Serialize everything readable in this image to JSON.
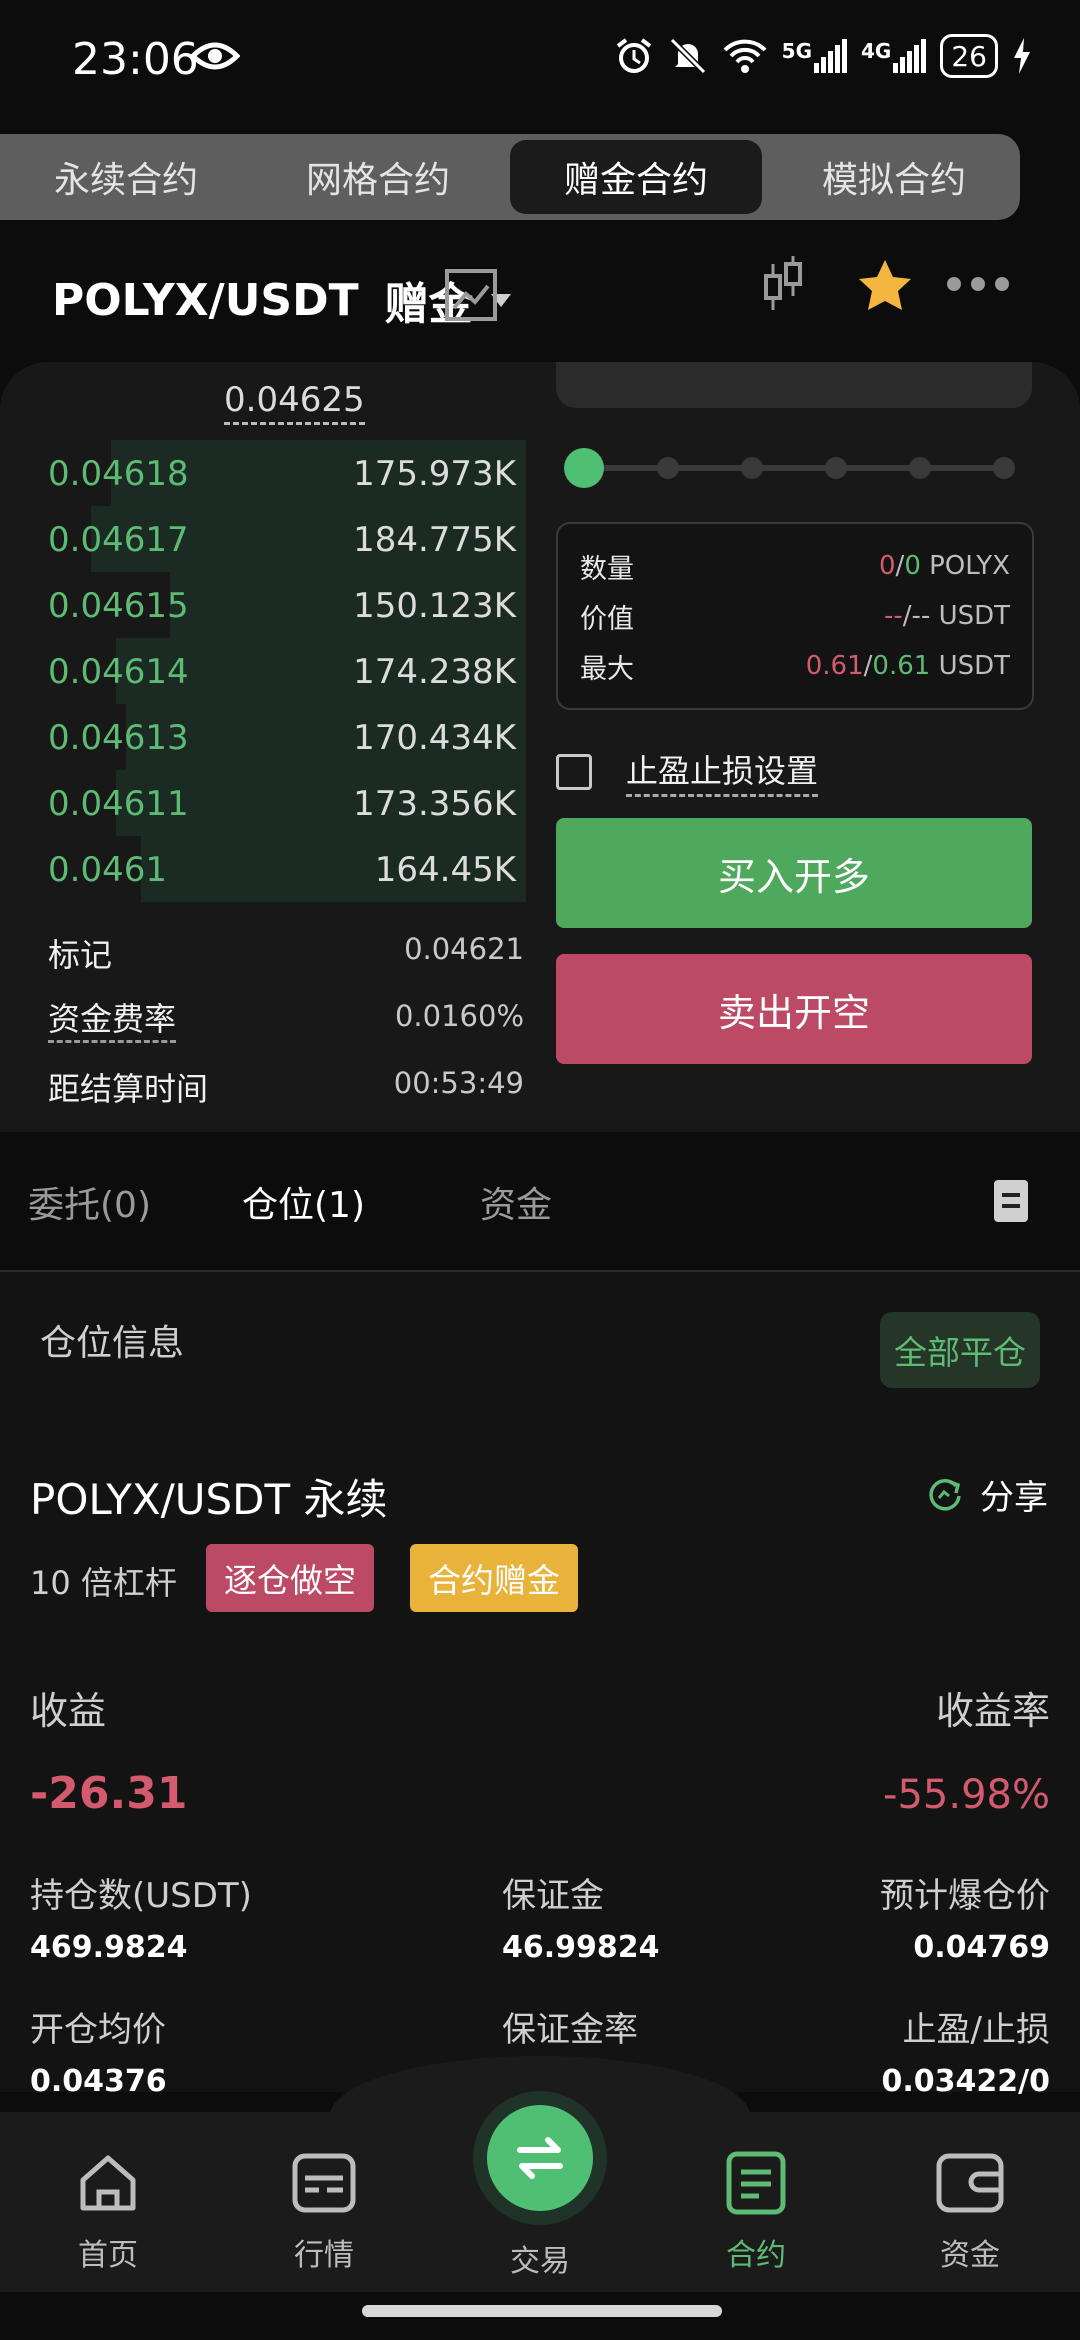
{
  "status_bar": {
    "time": "23:06",
    "net1": "5G",
    "net2": "4G",
    "battery": "26"
  },
  "mode_tabs": [
    {
      "label": "永续合约",
      "active": false
    },
    {
      "label": "网格合约",
      "active": false
    },
    {
      "label": "赠金合约",
      "active": true
    },
    {
      "label": "模拟合约",
      "active": false
    }
  ],
  "header": {
    "pair": "POLYX/USDT",
    "mode": "赠金"
  },
  "orderbook": {
    "mid_price": "0.04625",
    "rows": [
      {
        "price": "0.04618",
        "size": "175.973K",
        "depth": 0.84
      },
      {
        "price": "0.04617",
        "size": "184.775K",
        "depth": 0.88
      },
      {
        "price": "0.04615",
        "size": "150.123K",
        "depth": 0.72
      },
      {
        "price": "0.04614",
        "size": "174.238K",
        "depth": 0.83
      },
      {
        "price": "0.04613",
        "size": "170.434K",
        "depth": 0.81
      },
      {
        "price": "0.04611",
        "size": "173.356K",
        "depth": 0.83
      },
      {
        "price": "0.0461",
        "size": "164.45K",
        "depth": 0.78
      }
    ]
  },
  "market_info": {
    "mark_label": "标记",
    "mark_value": "0.04621",
    "funding_label": "资金费率",
    "funding_value": "0.0160%",
    "settle_label": "距结算时间",
    "settle_value": "00:53:49"
  },
  "order_form": {
    "slider_level": 0,
    "qty_label": "数量",
    "qty_a": "0",
    "qty_b": "0",
    "qty_unit": "POLYX",
    "value_label": "价值",
    "value_a": "--",
    "value_b": "--",
    "value_unit": "USDT",
    "max_label": "最大",
    "max_a": "0.61",
    "max_b": "0.61",
    "max_unit": "USDT",
    "tpsl_label": "止盈止损设置",
    "buy_label": "买入开多",
    "sell_label": "卖出开空"
  },
  "order_tabs": [
    {
      "label": "委托(0)",
      "active": false
    },
    {
      "label": "仓位(1)",
      "active": true
    },
    {
      "label": "资金",
      "active": false
    }
  ],
  "position": {
    "section_title": "仓位信息",
    "close_all": "全部平仓",
    "title": "POLYX/USDT 永续",
    "share": "分享",
    "leverage": "10 倍杠杆",
    "badge_side": "逐仓做空",
    "badge_bonus": "合约赠金",
    "pnl_label": "收益",
    "pnl_value": "-26.31",
    "roe_label": "收益率",
    "roe_value": "-55.98%",
    "size_label": "持仓数(USDT)",
    "size_value": "469.9824",
    "margin_label": "保证金",
    "margin_value": "46.99824",
    "liq_label": "预计爆仓价",
    "liq_value": "0.04769",
    "entry_label": "开仓均价",
    "entry_value": "0.04376",
    "margin_rate_label": "保证金率",
    "tpsl_label": "止盈/止损",
    "tpsl_value": "0.03422/0"
  },
  "bottom_nav": [
    {
      "label": "首页",
      "icon": "home-icon"
    },
    {
      "label": "行情",
      "icon": "market-icon"
    },
    {
      "label": "交易",
      "icon": "swap-icon"
    },
    {
      "label": "合约",
      "icon": "contract-icon",
      "active": true
    },
    {
      "label": "资金",
      "icon": "wallet-icon"
    }
  ],
  "colors": {
    "green": "#5dbb74",
    "red": "#d45a6e",
    "buy": "#4fa95c",
    "sell": "#bd4a65",
    "bonus": "#e9b23a"
  }
}
